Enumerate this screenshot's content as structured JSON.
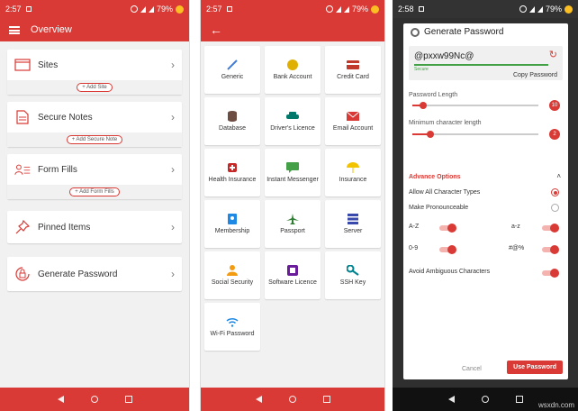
{
  "screen1": {
    "status": {
      "time": "2:57",
      "battery": "79%"
    },
    "title": "Overview",
    "cards": [
      {
        "label": "Sites",
        "icon": "browser-window-icon",
        "add": "+ Add Site"
      },
      {
        "label": "Secure Notes",
        "icon": "document-icon",
        "add": "+ Add Secure Note"
      },
      {
        "label": "Form Fills",
        "icon": "user-form-icon",
        "add": "+ Add Form Fills"
      },
      {
        "label": "Pinned Items",
        "icon": "pin-icon",
        "add": ""
      },
      {
        "label": "Generate Password",
        "icon": "lock-refresh-icon",
        "add": ""
      }
    ]
  },
  "screen2": {
    "status": {
      "time": "2:57",
      "battery": "79%"
    },
    "back": "←",
    "tiles": [
      {
        "label": "Generic",
        "color": "#3f7bd6"
      },
      {
        "label": "Bank Account",
        "color": "#e0b000"
      },
      {
        "label": "Credit Card",
        "color": "#c0392b"
      },
      {
        "label": "Database",
        "color": "#6d4c41"
      },
      {
        "label": "Driver's Licence",
        "color": "#00796b"
      },
      {
        "label": "Email Account",
        "color": "#d93a35"
      },
      {
        "label": "Health Insurance",
        "color": "#c62828"
      },
      {
        "label": "Instant Messenger",
        "color": "#43a047"
      },
      {
        "label": "Insurance",
        "color": "#f2c400"
      },
      {
        "label": "Membership",
        "color": "#1e88e5"
      },
      {
        "label": "Passport",
        "color": "#2e7d32"
      },
      {
        "label": "Server",
        "color": "#3949ab"
      },
      {
        "label": "Social Security",
        "color": "#f39c12"
      },
      {
        "label": "Software Licence",
        "color": "#6a1b9a"
      },
      {
        "label": "SSH Key",
        "color": "#00838f"
      },
      {
        "label": "Wi-Fi Password",
        "color": "#1e88e5"
      }
    ]
  },
  "screen3": {
    "status": {
      "time": "2:58",
      "battery": "79%"
    },
    "dialog_title": "Generate Password",
    "password": "@pxxw99Nc@",
    "strength": "Secure",
    "copy_label": "Copy Password",
    "length_label": "Password Length",
    "length_value": "10",
    "min_label": "Minimum character length",
    "min_value": "2",
    "advance_label": "Advance Options",
    "option_all": "Allow All Character Types",
    "option_pron": "Make Pronounceable",
    "az_upper": "A-Z",
    "az_lower": "a-z",
    "digits": "0-9",
    "symbols": "#@%",
    "ambiguous": "Avoid Ambiguous Characters",
    "cancel": "Cancel",
    "use": "Use Password"
  },
  "watermark": "wsxdn.com"
}
